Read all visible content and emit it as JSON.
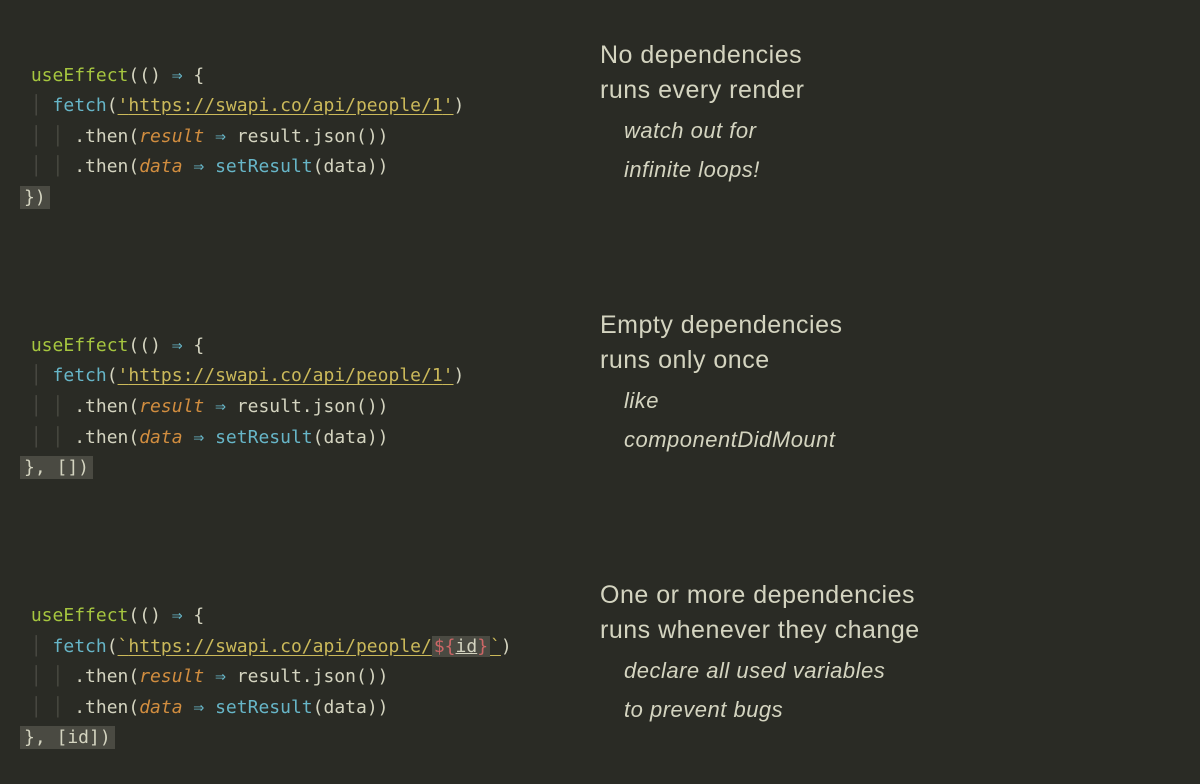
{
  "blocks": [
    {
      "code": {
        "fn": "useEffect",
        "open": "(() ",
        "arrow1": "⇒",
        "openBrace": " {",
        "fetchCall": "fetch",
        "quote1": "'",
        "url": "https://swapi.co/api/people/1",
        "quote2": "'",
        "fetchClose": ")",
        "then1": ".then(",
        "p1": "result",
        "arrow2": " ⇒ ",
        "r1a": "result",
        "r1b": ".json())",
        "then2": ".then(",
        "p2": "data",
        "arrow3": " ⇒ ",
        "setResult": "setResult",
        "r2": "(data))",
        "end": "})"
      },
      "explain": {
        "line1": "No dependencies",
        "line2": "runs every render",
        "sub1": "watch out for",
        "sub2": "infinite loops!"
      }
    },
    {
      "code": {
        "fn": "useEffect",
        "open": "(() ",
        "arrow1": "⇒",
        "openBrace": " {",
        "fetchCall": "fetch",
        "quote1": "'",
        "url": "https://swapi.co/api/people/1",
        "quote2": "'",
        "fetchClose": ")",
        "then1": ".then(",
        "p1": "result",
        "arrow2": " ⇒ ",
        "r1a": "result",
        "r1b": ".json())",
        "then2": ".then(",
        "p2": "data",
        "arrow3": " ⇒ ",
        "setResult": "setResult",
        "r2": "(data))",
        "end": "}, [])"
      },
      "explain": {
        "line1": "Empty dependencies",
        "line2": "runs only once",
        "sub1": "like",
        "sub2": "componentDidMount"
      }
    },
    {
      "code": {
        "fn": "useEffect",
        "open": "(() ",
        "arrow1": "⇒",
        "openBrace": " {",
        "fetchCall": "fetch",
        "quote1": "`",
        "url": "https://swapi.co/api/people/",
        "interpOpen": "${",
        "interpVar": "id",
        "interpClose": "}",
        "quote2": "`",
        "fetchClose": ")",
        "then1": ".then(",
        "p1": "result",
        "arrow2": " ⇒ ",
        "r1a": "result",
        "r1b": ".json())",
        "then2": ".then(",
        "p2": "data",
        "arrow3": " ⇒ ",
        "setResult": "setResult",
        "r2": "(data))",
        "end": "}, [id])"
      },
      "explain": {
        "line1": "One or more dependencies",
        "line2": "runs whenever they change",
        "sub1": "declare all used variables",
        "sub2": "to prevent bugs"
      }
    }
  ]
}
